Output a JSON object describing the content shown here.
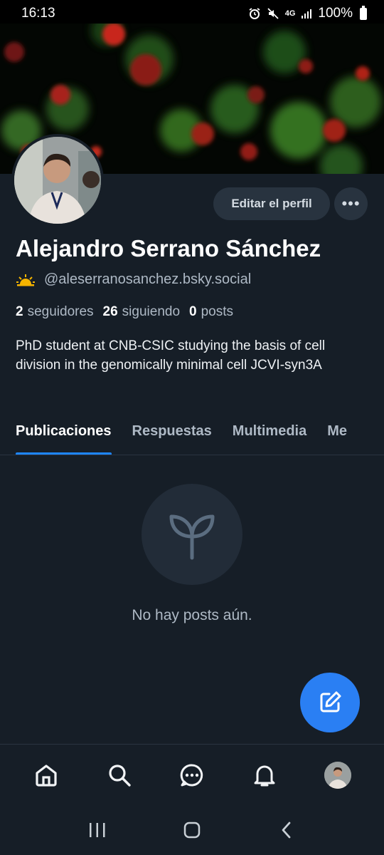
{
  "status_bar": {
    "time": "16:13",
    "network": "4G",
    "battery": "100%",
    "icons": [
      "alarm-icon",
      "mute-icon",
      "network-4g-icon",
      "signal-icon",
      "battery-icon"
    ]
  },
  "profile": {
    "display_name": "Alejandro Serrano Sánchez",
    "handle": "@aleserranosanchez.bsky.social",
    "handle_emoji": "sunrise-icon",
    "edit_label": "Editar el perfil",
    "more_label": "•••",
    "stats": [
      {
        "count": "2",
        "label": "seguidores"
      },
      {
        "count": "26",
        "label": "siguiendo"
      },
      {
        "count": "0",
        "label": "posts"
      }
    ],
    "bio": "PhD student at CNB-CSIC studying the basis of cell division in the genomically minimal cell JCVI-syn3A"
  },
  "tabs": [
    {
      "label": "Publicaciones",
      "active": true
    },
    {
      "label": "Respuestas",
      "active": false
    },
    {
      "label": "Multimedia",
      "active": false
    },
    {
      "label": "Me",
      "active": false
    }
  ],
  "empty_state": {
    "icon": "sprout-icon",
    "message": "No hay posts aún."
  },
  "fab": {
    "icon": "compose-icon"
  },
  "bottom_nav": [
    "home-icon",
    "search-icon",
    "chat-icon",
    "bell-icon",
    "profile-avatar"
  ],
  "colors": {
    "background": "#161e27",
    "accent": "#1e86ff",
    "fab": "#2a7ff3",
    "muted_text": "#aeb9c5",
    "button_bg": "#28333f"
  }
}
